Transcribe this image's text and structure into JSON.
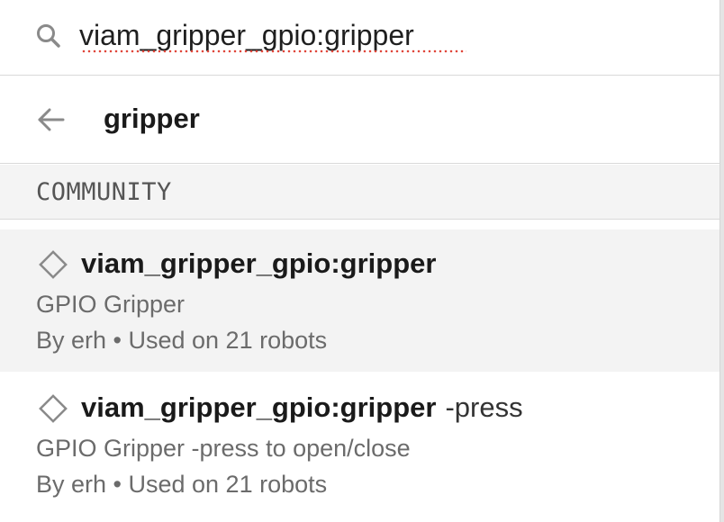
{
  "search": {
    "value": "viam_gripper_gpio:gripper",
    "icon": "search-icon"
  },
  "nav": {
    "back_icon": "arrow-left-icon",
    "title": "gripper"
  },
  "section": {
    "label": "COMMUNITY"
  },
  "results": [
    {
      "icon": "diamond-icon",
      "name": "viam_gripper_gpio:gripper",
      "suffix": "",
      "description": "GPIO Gripper",
      "meta": "By erh • Used on 21 robots",
      "selected": true
    },
    {
      "icon": "diamond-icon",
      "name": "viam_gripper_gpio:gripper",
      "suffix": "-press",
      "description": "GPIO Gripper -press to open/close",
      "meta": "By erh • Used on 21 robots",
      "selected": false
    }
  ],
  "colors": {
    "selected_bg": "#f3f3f3",
    "section_bg": "#f4f4f4",
    "spellcheck": "#e0463a"
  }
}
